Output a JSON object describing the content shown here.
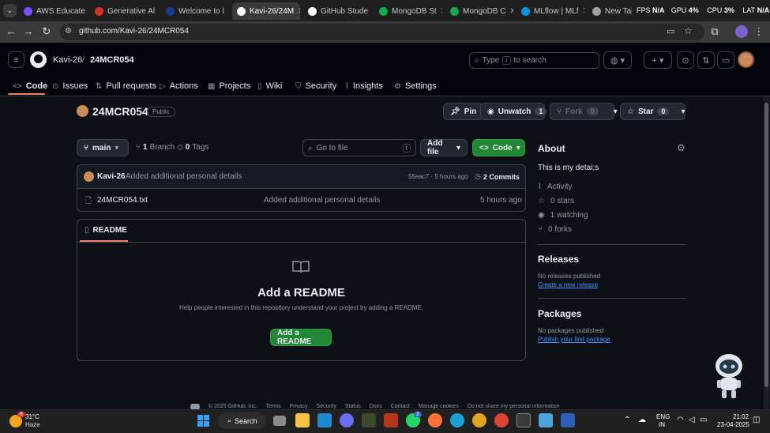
{
  "browser": {
    "tabs": [
      {
        "label": "AWS Educate",
        "color": "#7c4dff"
      },
      {
        "label": "Generative Al",
        "color": "#d93025"
      },
      {
        "label": "Welcome to I",
        "color": "#1a3d8f"
      },
      {
        "label": "Kavi-26/24M",
        "color": "#ffffff"
      },
      {
        "label": "GitHub Stude",
        "color": "#ffffff"
      },
      {
        "label": "MongoDB St",
        "color": "#13aa52"
      },
      {
        "label": "MongoDB C",
        "color": "#13aa52"
      },
      {
        "label": "MLflow | MLf",
        "color": "#0194e2"
      },
      {
        "label": "New Tab",
        "color": "#9aa0a6"
      }
    ],
    "url": "github.com/Kavi-26/24MCR054",
    "overlay": {
      "fps_label": "FPS",
      "fps": "N/A",
      "gpu_label": "GPU",
      "gpu": "4%",
      "cpu_label": "CPU",
      "cpu": "3%",
      "lat_label": "LAT",
      "lat": "N/A"
    }
  },
  "github": {
    "owner": "Kavi-26",
    "sep": "/",
    "repo": "24MCR054",
    "search_pre": "Type",
    "search_key": "/",
    "search_post": "to search",
    "nav": [
      "Code",
      "Issues",
      "Pull requests",
      "Actions",
      "Projects",
      "Wiki",
      "Security",
      "Insights",
      "Settings"
    ],
    "visibility": "Public",
    "pin": "Pin",
    "unwatch": "Unwatch",
    "unwatch_count": "1",
    "fork": "Fork",
    "fork_count": "0",
    "star": "Star",
    "star_count": "0",
    "branch": "main",
    "branches_n": "1",
    "branches_label": "Branch",
    "tags_n": "0",
    "tags_label": "Tags",
    "goto_file": "Go to file",
    "goto_key": "t",
    "add_file": "Add file",
    "code_btn": "Code",
    "commit": {
      "author": "Kavi-26",
      "message": "Added additional personal details",
      "meta": "55eac7 · 5 hours ago",
      "commits": "2 Commits"
    },
    "files": [
      {
        "name": "24MCR054.txt",
        "message": "Added additional personal details",
        "time": "5 hours ago"
      }
    ],
    "readme_tab": "README",
    "readme_title": "Add a README",
    "readme_desc": "Help people interested in this repository understand your project by adding a README.",
    "readme_btn": "Add a README",
    "about": {
      "heading": "About",
      "desc": "This is my detai;s",
      "activity": "Activity",
      "stars": "0 stars",
      "watching": "1 watching",
      "forks": "0 forks"
    },
    "releases": {
      "heading": "Releases",
      "none": "No releases published",
      "link": "Create a new release"
    },
    "packages": {
      "heading": "Packages",
      "none": "No packages published",
      "link": "Publish your first package"
    },
    "footer": [
      "© 2025 GitHub, Inc.",
      "Terms",
      "Privacy",
      "Security",
      "Status",
      "Docs",
      "Contact",
      "Manage cookies",
      "Do not share my personal information"
    ]
  },
  "taskbar": {
    "temp": "31°C",
    "weather": "Haze",
    "weather_badge": "6",
    "search": "Search",
    "lang1": "ENG",
    "lang2": "IN",
    "time": "21:02",
    "date": "23-04-2025",
    "whatsapp_badge": "2"
  },
  "colors": {
    "accent": "#f78166",
    "green": "#238636",
    "link": "#4493f8"
  }
}
